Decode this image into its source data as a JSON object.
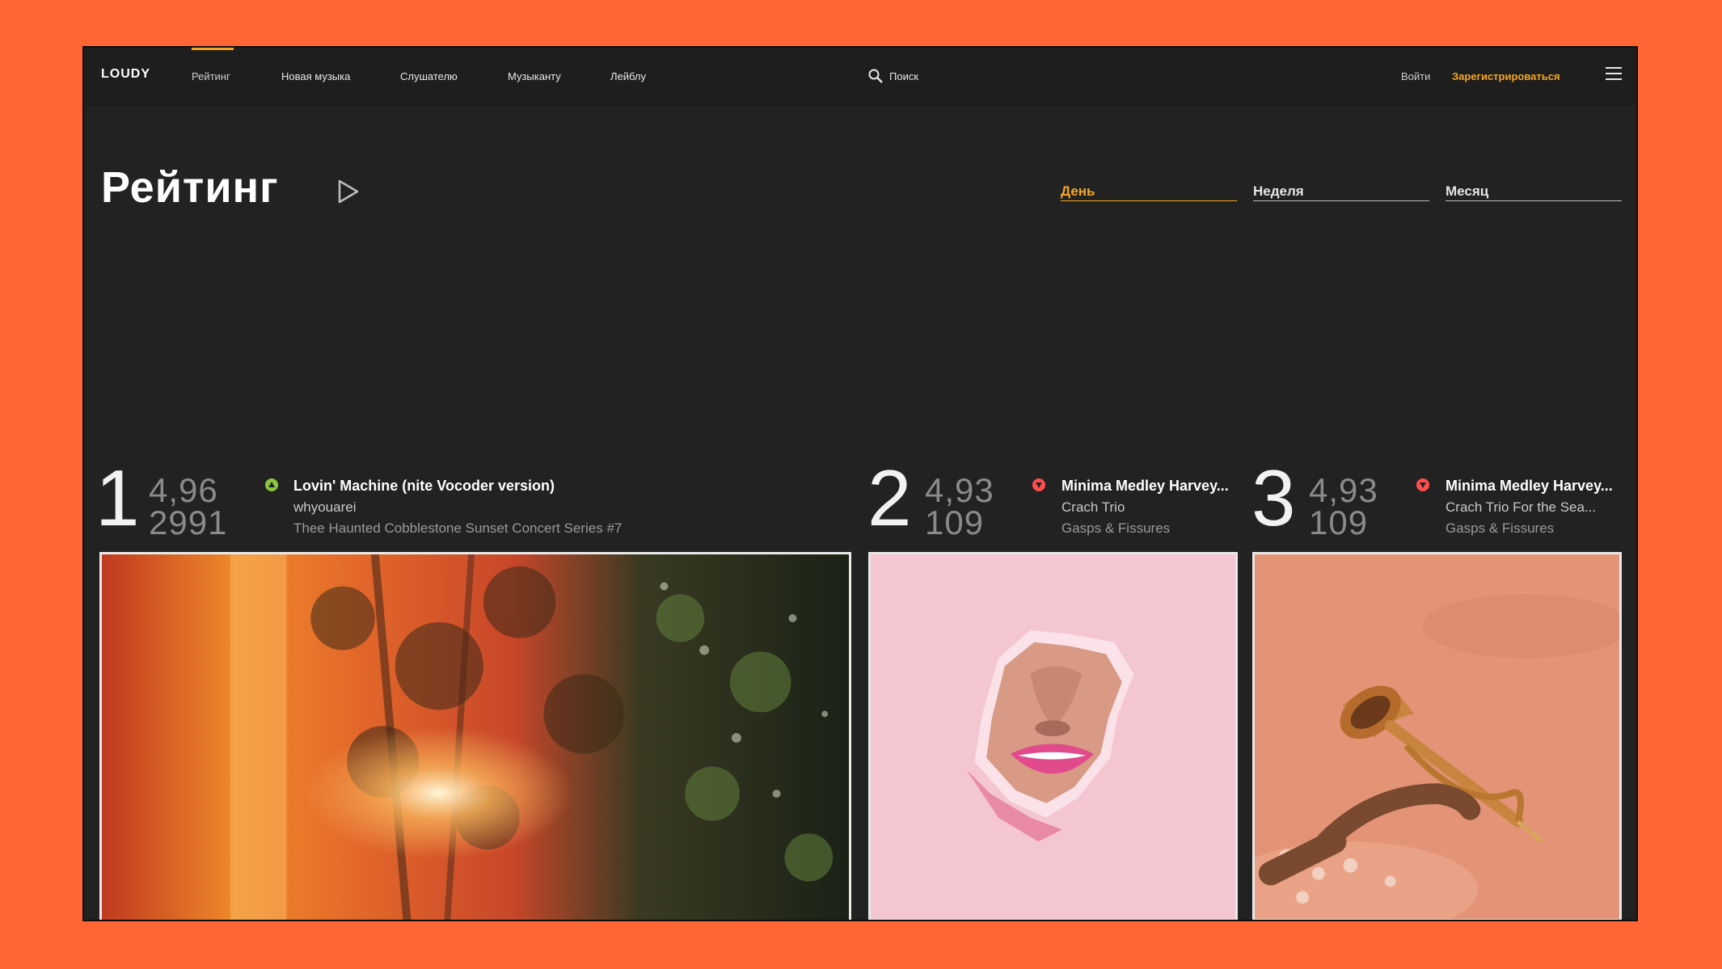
{
  "header": {
    "logo": "LOUDY",
    "nav": [
      "Рейтинг",
      "Новая музыка",
      "Слушателю",
      "Музыканту",
      "Лейблу"
    ],
    "search_label": "Поиск",
    "login": "Войти",
    "register": "Зарегистрироваться",
    "accent_color": "#f5a623"
  },
  "main": {
    "title": "Рейтинг",
    "period_tabs": [
      "День",
      "Неделя",
      "Месяц"
    ],
    "active_period": "День"
  },
  "chart": [
    {
      "rank": "1",
      "rating": "4,96",
      "votes": "2991",
      "trend": "up",
      "title": "Lovin' Machine (nite Vocoder version)",
      "artist": "whyouarei",
      "album": "Thee Haunted Cobblestone Sunset Concert Series #7"
    },
    {
      "rank": "2",
      "rating": "4,93",
      "votes": "109",
      "trend": "down",
      "title": "Minima Medley Harvey...",
      "artist": "Crach Trio",
      "album": "Gasps & Fissures"
    },
    {
      "rank": "3",
      "rating": "4,93",
      "votes": "109",
      "trend": "down",
      "title": "Minima Medley Harvey...",
      "artist": "Crach Trio For the Sea...",
      "album": "Gasps & Fissures"
    }
  ],
  "colors": {
    "up": "#8cc63f",
    "down": "#ff4d4d",
    "background": "#ff6633",
    "panel": "#222222"
  }
}
